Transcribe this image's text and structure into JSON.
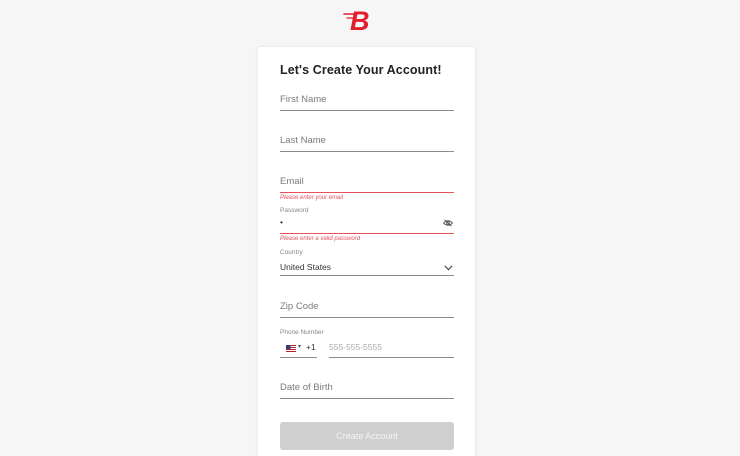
{
  "brand": {
    "logo_letter": "B",
    "accent_color": "#e21d2c"
  },
  "form": {
    "title": "Let's Create Your Account!",
    "first_name": {
      "placeholder": "First Name"
    },
    "last_name": {
      "placeholder": "Last Name"
    },
    "email": {
      "placeholder": "Email",
      "error": "Please enter your email"
    },
    "password": {
      "label": "Password",
      "value": "•",
      "error": "Please enter a valid password",
      "toggle_icon": "eye-off-icon"
    },
    "country": {
      "label": "Country",
      "value": "United States",
      "icon": "chevron-down-icon"
    },
    "zip": {
      "placeholder": "Zip Code"
    },
    "phone": {
      "label": "Phone Number",
      "country_flag": "us-flag-icon",
      "dial_code": "+1",
      "placeholder": "555-555-5555"
    },
    "dob": {
      "placeholder": "Date of Birth"
    },
    "submit_label": "Create Account"
  },
  "colors": {
    "error": "#e8505b",
    "button_disabled": "#cfcfcf",
    "background": "#f6f6f6"
  }
}
